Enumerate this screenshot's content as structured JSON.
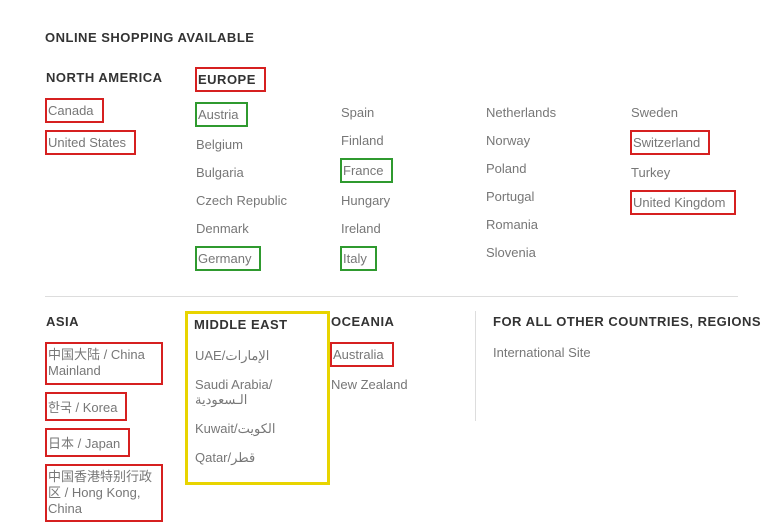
{
  "title": "ONLINE SHOPPING AVAILABLE",
  "na": {
    "heading": "NORTH AMERICA",
    "canada": "Canada",
    "us": "United States"
  },
  "eu": {
    "heading": "EUROPE",
    "austria": "Austria",
    "belgium": "Belgium",
    "bulgaria": "Bulgaria",
    "czech": "Czech Republic",
    "denmark": "Denmark",
    "germany": "Germany",
    "spain": "Spain",
    "finland": "Finland",
    "france": "France",
    "hungary": "Hungary",
    "ireland": "Ireland",
    "italy": "Italy",
    "netherlands": "Netherlands",
    "norway": "Norway",
    "poland": "Poland",
    "portugal": "Portugal",
    "romania": "Romania",
    "slovenia": "Slovenia",
    "sweden": "Sweden",
    "switzerland": "Switzerland",
    "turkey": "Turkey",
    "uk": "United Kingdom"
  },
  "asia": {
    "heading": "ASIA",
    "china": "中国大陆 / China Mainland",
    "korea": "한국 / Korea",
    "japan": "日本 / Japan",
    "hk": "中国香港特别行政区 / Hong Kong, China"
  },
  "me": {
    "heading": "MIDDLE EAST",
    "uae": "UAE/الإمارات",
    "sa": "Saudi Arabia/الـسعودية",
    "kw": "Kuwait/الكويت",
    "qa": "Qatar/قطر"
  },
  "oc": {
    "heading": "OCEANIA",
    "au": "Australia",
    "nz": "New Zealand"
  },
  "other": {
    "heading": "FOR ALL OTHER COUNTRIES, REGIONS",
    "intl": "International Site"
  }
}
